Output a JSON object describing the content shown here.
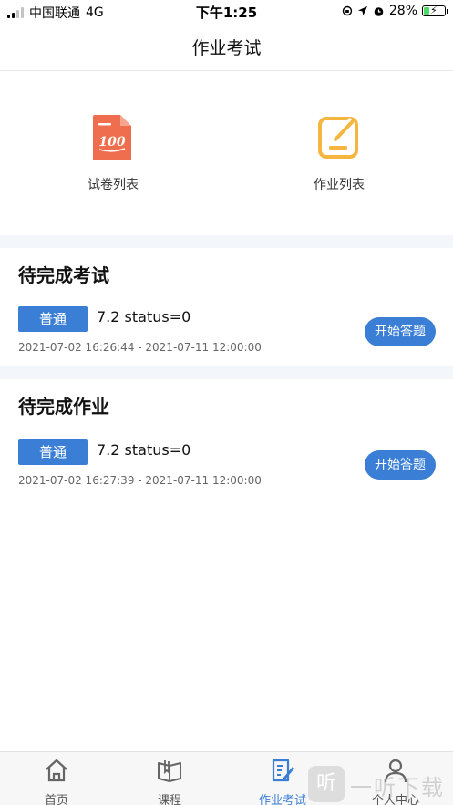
{
  "status_bar": {
    "carrier": "中国联通",
    "network": "4G",
    "time": "下午1:25",
    "battery": "28%",
    "battery_level": 0.28
  },
  "nav": {
    "title": "作业考试"
  },
  "quick_entries": [
    {
      "label": "试卷列表",
      "icon": "exam-paper-icon",
      "color": "#ee6e4d"
    },
    {
      "label": "作业列表",
      "icon": "homework-edit-icon",
      "color": "#f5b640"
    }
  ],
  "exams": {
    "title": "待完成考试",
    "items": [
      {
        "tag": "普通",
        "title": "7.2 status=0",
        "time": "2021-07-02 16:26:44 - 2021-07-11 12:00:00",
        "action": "开始答题"
      }
    ]
  },
  "homework": {
    "title": "待完成作业",
    "items": [
      {
        "tag": "普通",
        "title": "7.2 status=0",
        "time": "2021-07-02 16:27:39 - 2021-07-11 12:00:00",
        "action": "开始答题"
      }
    ]
  },
  "tab_bar": {
    "tabs": [
      {
        "label": "首页",
        "icon": "home-icon",
        "active": false
      },
      {
        "label": "课程",
        "icon": "book-icon",
        "active": false
      },
      {
        "label": "作业考试",
        "icon": "exam-edit-icon",
        "active": true
      },
      {
        "label": "个人中心",
        "icon": "person-icon",
        "active": false
      }
    ]
  },
  "watermark": {
    "badge": "听",
    "text": "一听下载"
  },
  "colors": {
    "accent": "#3a7fd5",
    "exam_icon": "#ee6e4d",
    "homework_icon": "#f5b640"
  }
}
